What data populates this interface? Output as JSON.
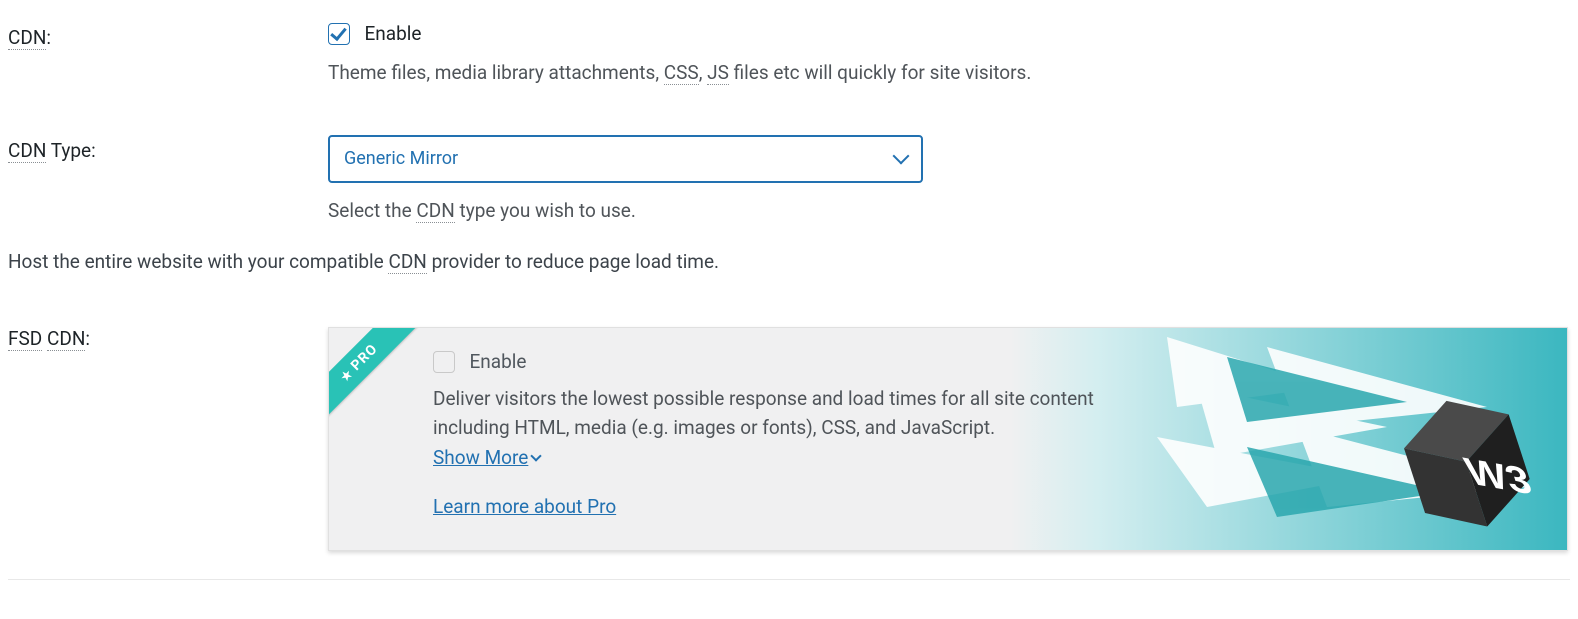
{
  "cdn": {
    "label_prefix": "CDN",
    "label_suffix": ":",
    "enable_label": "Enable",
    "description_pre": "Theme files, media library attachments, ",
    "abbr_css": "CSS",
    "sep1": ", ",
    "abbr_js": "JS",
    "description_post": " files etc will quickly for site visitors."
  },
  "cdn_type": {
    "label_prefix": "CDN",
    "label_suffix": " Type:",
    "selected": "Generic Mirror",
    "description_pre": "Select the ",
    "abbr_cdn": "CDN",
    "description_post": " type you wish to use."
  },
  "section": {
    "text_pre": "Host the entire website with your compatible ",
    "abbr_cdn": "CDN",
    "text_post": " provider to reduce page load time."
  },
  "fsd": {
    "label_fsd": "FSD",
    "label_space": " ",
    "label_cdn": "CDN",
    "label_suffix": ":",
    "ribbon": "PRO",
    "enable_label": "Enable",
    "description": "Deliver visitors the lowest possible response and load times for all site content including HTML, media (e.g. images or fonts), CSS, and JavaScript.",
    "show_more": "Show More",
    "learn_more": "Learn more about Pro",
    "logo_text": "W3"
  }
}
